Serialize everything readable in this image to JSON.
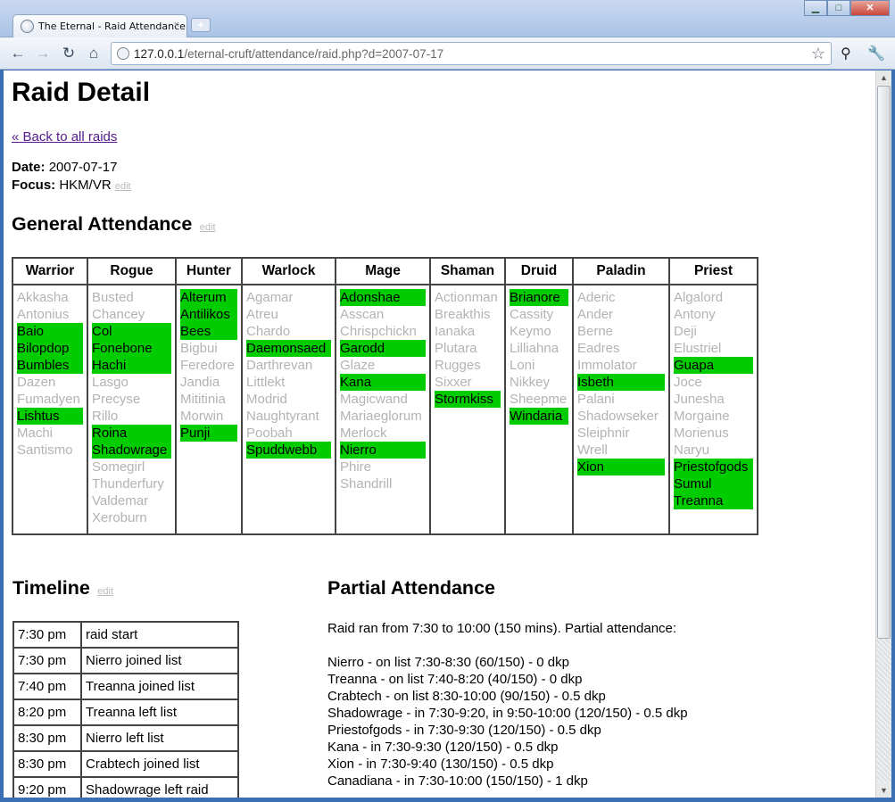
{
  "browser": {
    "tab_title": "The Eternal - Raid Attendance",
    "tab_close": "×",
    "new_tab": "+",
    "url_host": "127.0.0.1",
    "url_path": "/eternal-cruft/attendance/raid.php?d=2007-07-17",
    "window_min": "▁",
    "window_max": "□",
    "window_close": "✕"
  },
  "page": {
    "title": "Raid Detail",
    "back_link": "« Back to all raids",
    "date_label": "Date:",
    "date_value": "2007-07-17",
    "focus_label": "Focus:",
    "focus_value": "HKM/VR",
    "edit": "edit",
    "general_heading": "General Attendance",
    "timeline_heading": "Timeline",
    "partial_heading": "Partial Attendance"
  },
  "classes": [
    {
      "name": "Warrior",
      "members": [
        {
          "n": "Akkasha",
          "on": false
        },
        {
          "n": "Antonius",
          "on": false
        },
        {
          "n": "Baio",
          "on": true
        },
        {
          "n": "Bilopdop",
          "on": true
        },
        {
          "n": "Bumbles",
          "on": true
        },
        {
          "n": "Dazen",
          "on": false
        },
        {
          "n": "Fumadyen",
          "on": false
        },
        {
          "n": "Lishtus",
          "on": true
        },
        {
          "n": "Machi",
          "on": false
        },
        {
          "n": "Santismo",
          "on": false
        }
      ]
    },
    {
      "name": "Rogue",
      "members": [
        {
          "n": "Busted",
          "on": false
        },
        {
          "n": "Chancey",
          "on": false
        },
        {
          "n": "Col",
          "on": true
        },
        {
          "n": "Fonebone",
          "on": true
        },
        {
          "n": "Hachi",
          "on": true
        },
        {
          "n": "Lasgo",
          "on": false
        },
        {
          "n": "Precyse",
          "on": false
        },
        {
          "n": "Rillo",
          "on": false
        },
        {
          "n": "Roina",
          "on": true
        },
        {
          "n": "Shadowrage",
          "on": true
        },
        {
          "n": "Somegirl",
          "on": false
        },
        {
          "n": "Thunderfury",
          "on": false
        },
        {
          "n": "Valdemar",
          "on": false
        },
        {
          "n": "Xeroburn",
          "on": false
        }
      ]
    },
    {
      "name": "Hunter",
      "members": [
        {
          "n": "Alterum",
          "on": true
        },
        {
          "n": "Antilikos",
          "on": true
        },
        {
          "n": "Bees",
          "on": true
        },
        {
          "n": "Bigbui",
          "on": false
        },
        {
          "n": "Feredore",
          "on": false
        },
        {
          "n": "Jandia",
          "on": false
        },
        {
          "n": "Mititinia",
          "on": false
        },
        {
          "n": "Morwin",
          "on": false
        },
        {
          "n": "Punji",
          "on": true
        }
      ]
    },
    {
      "name": "Warlock",
      "members": [
        {
          "n": "Agamar",
          "on": false
        },
        {
          "n": "Atreu",
          "on": false
        },
        {
          "n": "Chardo",
          "on": false
        },
        {
          "n": "Daemonsaed",
          "on": true
        },
        {
          "n": "Darthrevan",
          "on": false
        },
        {
          "n": "Littlekt",
          "on": false
        },
        {
          "n": "Modrid",
          "on": false
        },
        {
          "n": "Naughtyrant",
          "on": false
        },
        {
          "n": "Poobah",
          "on": false
        },
        {
          "n": "Spuddwebb",
          "on": true
        }
      ]
    },
    {
      "name": "Mage",
      "members": [
        {
          "n": "Adonshae",
          "on": true
        },
        {
          "n": "Asscan",
          "on": false
        },
        {
          "n": "Chrispchickn",
          "on": false
        },
        {
          "n": "Garodd",
          "on": true
        },
        {
          "n": "Glaze",
          "on": false
        },
        {
          "n": "Kana",
          "on": true
        },
        {
          "n": "Magicwand",
          "on": false
        },
        {
          "n": "Mariaeglorum",
          "on": false
        },
        {
          "n": "Merlock",
          "on": false
        },
        {
          "n": "Nierro",
          "on": true
        },
        {
          "n": "Phire",
          "on": false
        },
        {
          "n": "Shandrill",
          "on": false
        }
      ]
    },
    {
      "name": "Shaman",
      "members": [
        {
          "n": "Actionman",
          "on": false
        },
        {
          "n": "Breakthis",
          "on": false
        },
        {
          "n": "Ianaka",
          "on": false
        },
        {
          "n": "Plutara",
          "on": false
        },
        {
          "n": "Rugges",
          "on": false
        },
        {
          "n": "Sixxer",
          "on": false
        },
        {
          "n": "Stormkiss",
          "on": true
        }
      ]
    },
    {
      "name": "Druid",
      "members": [
        {
          "n": "Brianore",
          "on": true
        },
        {
          "n": "Cassity",
          "on": false
        },
        {
          "n": "Keymo",
          "on": false
        },
        {
          "n": "Lilliahna",
          "on": false
        },
        {
          "n": "Loni",
          "on": false
        },
        {
          "n": "Nikkey",
          "on": false
        },
        {
          "n": "Sheepme",
          "on": false
        },
        {
          "n": "Windaria",
          "on": true
        }
      ]
    },
    {
      "name": "Paladin",
      "members": [
        {
          "n": "Aderic",
          "on": false
        },
        {
          "n": "Ander",
          "on": false
        },
        {
          "n": "Berne",
          "on": false
        },
        {
          "n": "Eadres",
          "on": false
        },
        {
          "n": "Immolator",
          "on": false
        },
        {
          "n": "Isbeth",
          "on": true
        },
        {
          "n": "Palani",
          "on": false
        },
        {
          "n": "Shadowseker",
          "on": false
        },
        {
          "n": "Sleiphnir",
          "on": false
        },
        {
          "n": "Wrell",
          "on": false
        },
        {
          "n": "Xion",
          "on": true
        }
      ]
    },
    {
      "name": "Priest",
      "members": [
        {
          "n": "Algalord",
          "on": false
        },
        {
          "n": "Antony",
          "on": false
        },
        {
          "n": "Deji",
          "on": false
        },
        {
          "n": "Elustriel",
          "on": false
        },
        {
          "n": "Guapa",
          "on": true
        },
        {
          "n": "Joce",
          "on": false
        },
        {
          "n": "Junesha",
          "on": false
        },
        {
          "n": "Morgaine",
          "on": false
        },
        {
          "n": "Morienus",
          "on": false
        },
        {
          "n": "Naryu",
          "on": false
        },
        {
          "n": "Priestofgods",
          "on": true
        },
        {
          "n": "Sumul",
          "on": true
        },
        {
          "n": "Treanna",
          "on": true
        }
      ]
    }
  ],
  "timeline": [
    {
      "time": "7:30 pm",
      "event": "raid start"
    },
    {
      "time": "7:30 pm",
      "event": "Nierro joined list"
    },
    {
      "time": "7:40 pm",
      "event": "Treanna joined list"
    },
    {
      "time": "8:20 pm",
      "event": "Treanna left list"
    },
    {
      "time": "8:30 pm",
      "event": "Nierro left list"
    },
    {
      "time": "8:30 pm",
      "event": "Crabtech joined list"
    },
    {
      "time": "9:20 pm",
      "event": "Shadowrage left raid"
    }
  ],
  "partial": {
    "intro": "Raid ran from 7:30 to 10:00 (150 mins). Partial attendance:",
    "lines": [
      "Nierro - on list 7:30-8:30 (60/150) - 0 dkp",
      "Treanna - on list 7:40-8:20 (40/150) - 0 dkp",
      "Crabtech - on list 8:30-10:00 (90/150) - 0.5 dkp",
      "Shadowrage - in 7:30-9:20, in 9:50-10:00 (120/150) - 0.5 dkp",
      "Priestofgods - in 7:30-9:30 (120/150) - 0.5 dkp",
      "Kana - in 7:30-9:30 (120/150) - 0.5 dkp",
      "Xion - in 7:30-9:40 (130/150) - 0.5 dkp",
      "Canadiana - in 7:30-10:00 (150/150) - 1 dkp"
    ]
  }
}
